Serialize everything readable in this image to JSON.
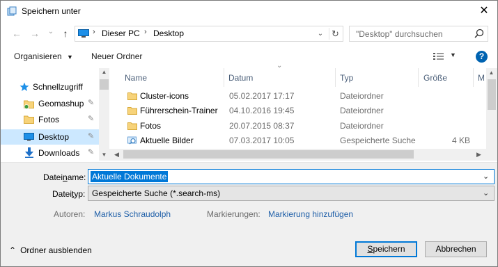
{
  "window": {
    "title": "Speichern unter",
    "close_glyph": "✕"
  },
  "navigation": {
    "back_glyph": "←",
    "forward_glyph": "→",
    "recent_glyph": "⌄",
    "up_glyph": "↑",
    "address": {
      "crumbs": [
        "Dieser PC",
        "Desktop"
      ],
      "separator": "›",
      "dropdown_glyph": "⌄",
      "refresh_glyph": "↻"
    },
    "search_placeholder": "\"Desktop\" durchsuchen"
  },
  "toolbar": {
    "organize_label": "Organisieren",
    "new_folder_label": "Neuer Ordner",
    "help_label": "?"
  },
  "nav_pane": {
    "items": [
      {
        "label": "Schnellzugriff",
        "icon": "star-icon",
        "pinned": false,
        "selected": false
      },
      {
        "label": "Geomashup",
        "icon": "folder-sync-icon",
        "pinned": true,
        "selected": false
      },
      {
        "label": "Fotos",
        "icon": "folder-icon",
        "pinned": true,
        "selected": false
      },
      {
        "label": "Desktop",
        "icon": "desktop-icon",
        "pinned": true,
        "selected": true
      },
      {
        "label": "Downloads",
        "icon": "download-icon",
        "pinned": true,
        "selected": false
      }
    ],
    "pin_glyph": "📌"
  },
  "file_list": {
    "columns": [
      "Name",
      "Datum",
      "Typ",
      "Größe",
      "M"
    ],
    "sort_glyph": "⌄",
    "rows": [
      {
        "name": "Cluster-icons",
        "date": "05.02.2017 17:17",
        "type": "Dateiordner",
        "size": "",
        "icon": "folder-icon"
      },
      {
        "name": "Führerschein-Trainer",
        "date": "04.10.2016 19:45",
        "type": "Dateiordner",
        "size": "",
        "icon": "folder-icon"
      },
      {
        "name": "Fotos",
        "date": "20.07.2015 08:37",
        "type": "Dateiordner",
        "size": "",
        "icon": "folder-icon"
      },
      {
        "name": "Aktuelle Bilder",
        "date": "07.03.2017 10:05",
        "type": "Gespeicherte Suche",
        "size": "4 KB",
        "icon": "saved-search-icon"
      }
    ]
  },
  "form": {
    "filename_label_pre": "Datei",
    "filename_label_u": "n",
    "filename_label_post": "ame:",
    "filename_value": "Aktuelle Dokumente",
    "filetype_label_pre": "Datei",
    "filetype_label_u": "t",
    "filetype_label_post": "yp:",
    "filetype_value": "Gespeicherte Suche (*.search-ms)",
    "authors_label": "Autoren:",
    "authors_value": "Markus Schraudolph",
    "tags_label": "Markierungen:",
    "tags_value": "Markierung hinzufügen",
    "dropdown_glyph": "⌄"
  },
  "footer": {
    "hide_folders_label": "Ordner ausblenden",
    "hide_glyph": "⌃",
    "save_label_pre": "",
    "save_label_u": "S",
    "save_label_post": "peichern",
    "cancel_label": "Abbrechen"
  },
  "colors": {
    "accent": "#0078d7",
    "selection": "#cce8ff",
    "link": "#1f5fa8",
    "header_text": "#4c607a"
  }
}
